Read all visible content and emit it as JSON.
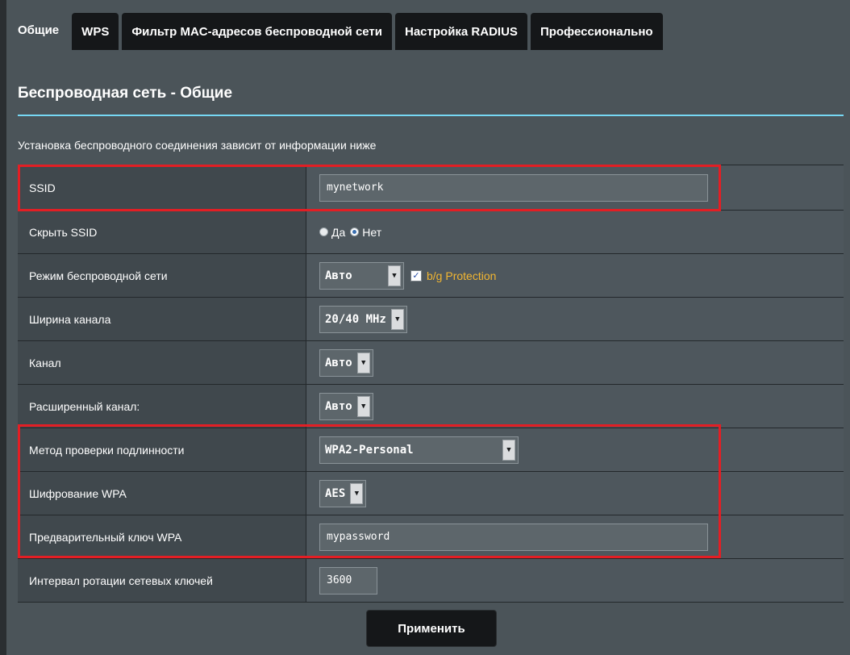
{
  "tabs": [
    "Общие",
    "WPS",
    "Фильтр MAC-адресов беспроводной сети",
    "Настройка RADIUS",
    "Профессионально"
  ],
  "active_tab_index": 0,
  "section_title": "Беспроводная сеть - Общие",
  "intro_text": "Установка беспроводного соединения зависит от информации ниже",
  "fields": {
    "ssid": {
      "label": "SSID",
      "value": "mynetwork"
    },
    "hide_ssid": {
      "label": "Скрыть SSID",
      "option_yes": "Да",
      "option_no": "Нет",
      "selected": "Нет"
    },
    "wireless_mode": {
      "label": "Режим беспроводной сети",
      "value": "Авто",
      "checkbox_label": "b/g Protection",
      "checkbox_checked": true
    },
    "channel_width": {
      "label": "Ширина канала",
      "value": "20/40 MHz"
    },
    "channel": {
      "label": "Канал",
      "value": "Авто"
    },
    "extended_channel": {
      "label": "Расширенный канал:",
      "value": "Авто"
    },
    "auth_method": {
      "label": "Метод проверки подлинности",
      "value": "WPA2-Personal"
    },
    "wpa_encryption": {
      "label": "Шифрование WPA",
      "value": "AES"
    },
    "wpa_key": {
      "label": "Предварительный ключ WPA",
      "value": "mypassword"
    },
    "key_rotation": {
      "label": "Интервал ротации сетевых ключей",
      "value": "3600"
    }
  },
  "apply_label": "Применить",
  "colors": {
    "highlight": "#e31e24",
    "accent_line": "#76d8f4",
    "checkbox_label": "#f2b631"
  }
}
